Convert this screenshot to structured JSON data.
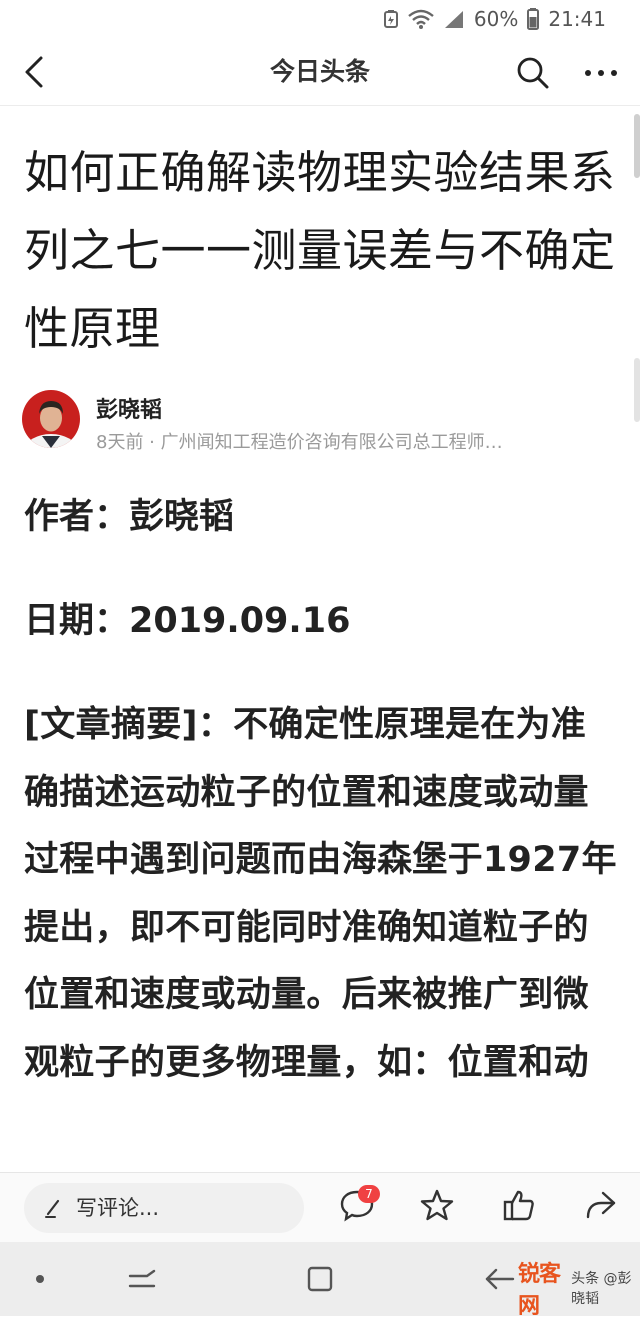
{
  "status_bar": {
    "battery_percent": "60%",
    "time": "21:41",
    "icons": [
      "battery-saver-icon",
      "wifi-icon",
      "signal-icon",
      "battery-icon"
    ]
  },
  "nav": {
    "title": "今日头条",
    "icons": [
      "back-icon",
      "search-icon",
      "more-icon"
    ]
  },
  "article": {
    "title": "如何正确解读物理实验结果系列之七一一测量误差与不确定性原理",
    "author": {
      "name": "彭晓韬",
      "meta": "8天前 · 广州闻知工程造价咨询有限公司总工程师…"
    },
    "paragraphs": {
      "author_line": "作者：彭晓韬",
      "date_line": "日期：2019.09.16",
      "summary": "[文章摘要]：不确定性原理是在为准确描述运动粒子的位置和速度或动量过程中遇到问题而由海森堡于1927年提出，即不可能同时准确知道粒子的位置和速度或动量。后来被推广到微观粒子的更多物理量，如：位置和动"
    }
  },
  "action_bar": {
    "comment_placeholder": "写评论...",
    "comment_count": "7",
    "icons": [
      "pen-icon",
      "comment-icon",
      "star-icon",
      "like-icon",
      "share-icon"
    ]
  },
  "system_nav": {
    "icons": [
      "dot-icon",
      "recent-apps-icon",
      "home-icon",
      "back-arrow-icon"
    ]
  },
  "watermark": {
    "logo": "锐客网",
    "text": "头条 @彭晓韬"
  }
}
